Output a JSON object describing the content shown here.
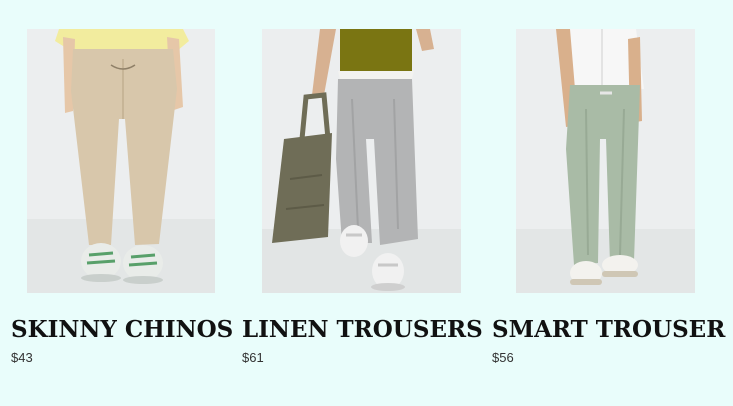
{
  "products": [
    {
      "name": "SKINNY CHINOS",
      "price": "$43",
      "image_alt": "Skinny chinos",
      "trouser_color": "#d8c7ab",
      "top_color": "#f2ec9e",
      "shoe_color": "#e9ece9",
      "shoe_accent": "#58a06a"
    },
    {
      "name": "LINEN TROUSERS",
      "price": "$61",
      "image_alt": "Linen trousers",
      "trouser_color": "#b3b4b5",
      "top_color": "#7a7512",
      "shoe_color": "#f1f1f1",
      "shoe_accent": "#c8c8c8",
      "bag_color": "#6f6d57"
    },
    {
      "name": "SMART TROUSER",
      "price": "$56",
      "image_alt": "Smart trouser",
      "trouser_color": "#a9bba6",
      "top_color": "#f7f7f7",
      "shoe_color": "#f3f2ee",
      "shoe_accent": "#cfc7b5"
    }
  ]
}
